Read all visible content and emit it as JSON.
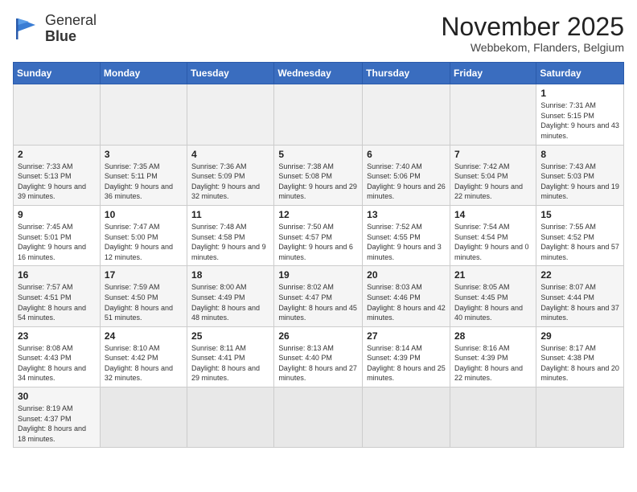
{
  "header": {
    "logo_text_normal": "General",
    "logo_text_bold": "Blue",
    "month_title": "November 2025",
    "location": "Webbekom, Flanders, Belgium"
  },
  "weekdays": [
    "Sunday",
    "Monday",
    "Tuesday",
    "Wednesday",
    "Thursday",
    "Friday",
    "Saturday"
  ],
  "weeks": [
    [
      {
        "day": "",
        "info": ""
      },
      {
        "day": "",
        "info": ""
      },
      {
        "day": "",
        "info": ""
      },
      {
        "day": "",
        "info": ""
      },
      {
        "day": "",
        "info": ""
      },
      {
        "day": "",
        "info": ""
      },
      {
        "day": "1",
        "info": "Sunrise: 7:31 AM\nSunset: 5:15 PM\nDaylight: 9 hours and 43 minutes."
      }
    ],
    [
      {
        "day": "2",
        "info": "Sunrise: 7:33 AM\nSunset: 5:13 PM\nDaylight: 9 hours and 39 minutes."
      },
      {
        "day": "3",
        "info": "Sunrise: 7:35 AM\nSunset: 5:11 PM\nDaylight: 9 hours and 36 minutes."
      },
      {
        "day": "4",
        "info": "Sunrise: 7:36 AM\nSunset: 5:09 PM\nDaylight: 9 hours and 32 minutes."
      },
      {
        "day": "5",
        "info": "Sunrise: 7:38 AM\nSunset: 5:08 PM\nDaylight: 9 hours and 29 minutes."
      },
      {
        "day": "6",
        "info": "Sunrise: 7:40 AM\nSunset: 5:06 PM\nDaylight: 9 hours and 26 minutes."
      },
      {
        "day": "7",
        "info": "Sunrise: 7:42 AM\nSunset: 5:04 PM\nDaylight: 9 hours and 22 minutes."
      },
      {
        "day": "8",
        "info": "Sunrise: 7:43 AM\nSunset: 5:03 PM\nDaylight: 9 hours and 19 minutes."
      }
    ],
    [
      {
        "day": "9",
        "info": "Sunrise: 7:45 AM\nSunset: 5:01 PM\nDaylight: 9 hours and 16 minutes."
      },
      {
        "day": "10",
        "info": "Sunrise: 7:47 AM\nSunset: 5:00 PM\nDaylight: 9 hours and 12 minutes."
      },
      {
        "day": "11",
        "info": "Sunrise: 7:48 AM\nSunset: 4:58 PM\nDaylight: 9 hours and 9 minutes."
      },
      {
        "day": "12",
        "info": "Sunrise: 7:50 AM\nSunset: 4:57 PM\nDaylight: 9 hours and 6 minutes."
      },
      {
        "day": "13",
        "info": "Sunrise: 7:52 AM\nSunset: 4:55 PM\nDaylight: 9 hours and 3 minutes."
      },
      {
        "day": "14",
        "info": "Sunrise: 7:54 AM\nSunset: 4:54 PM\nDaylight: 9 hours and 0 minutes."
      },
      {
        "day": "15",
        "info": "Sunrise: 7:55 AM\nSunset: 4:52 PM\nDaylight: 8 hours and 57 minutes."
      }
    ],
    [
      {
        "day": "16",
        "info": "Sunrise: 7:57 AM\nSunset: 4:51 PM\nDaylight: 8 hours and 54 minutes."
      },
      {
        "day": "17",
        "info": "Sunrise: 7:59 AM\nSunset: 4:50 PM\nDaylight: 8 hours and 51 minutes."
      },
      {
        "day": "18",
        "info": "Sunrise: 8:00 AM\nSunset: 4:49 PM\nDaylight: 8 hours and 48 minutes."
      },
      {
        "day": "19",
        "info": "Sunrise: 8:02 AM\nSunset: 4:47 PM\nDaylight: 8 hours and 45 minutes."
      },
      {
        "day": "20",
        "info": "Sunrise: 8:03 AM\nSunset: 4:46 PM\nDaylight: 8 hours and 42 minutes."
      },
      {
        "day": "21",
        "info": "Sunrise: 8:05 AM\nSunset: 4:45 PM\nDaylight: 8 hours and 40 minutes."
      },
      {
        "day": "22",
        "info": "Sunrise: 8:07 AM\nSunset: 4:44 PM\nDaylight: 8 hours and 37 minutes."
      }
    ],
    [
      {
        "day": "23",
        "info": "Sunrise: 8:08 AM\nSunset: 4:43 PM\nDaylight: 8 hours and 34 minutes."
      },
      {
        "day": "24",
        "info": "Sunrise: 8:10 AM\nSunset: 4:42 PM\nDaylight: 8 hours and 32 minutes."
      },
      {
        "day": "25",
        "info": "Sunrise: 8:11 AM\nSunset: 4:41 PM\nDaylight: 8 hours and 29 minutes."
      },
      {
        "day": "26",
        "info": "Sunrise: 8:13 AM\nSunset: 4:40 PM\nDaylight: 8 hours and 27 minutes."
      },
      {
        "day": "27",
        "info": "Sunrise: 8:14 AM\nSunset: 4:39 PM\nDaylight: 8 hours and 25 minutes."
      },
      {
        "day": "28",
        "info": "Sunrise: 8:16 AM\nSunset: 4:39 PM\nDaylight: 8 hours and 22 minutes."
      },
      {
        "day": "29",
        "info": "Sunrise: 8:17 AM\nSunset: 4:38 PM\nDaylight: 8 hours and 20 minutes."
      }
    ],
    [
      {
        "day": "30",
        "info": "Sunrise: 8:19 AM\nSunset: 4:37 PM\nDaylight: 8 hours and 18 minutes."
      },
      {
        "day": "",
        "info": ""
      },
      {
        "day": "",
        "info": ""
      },
      {
        "day": "",
        "info": ""
      },
      {
        "day": "",
        "info": ""
      },
      {
        "day": "",
        "info": ""
      },
      {
        "day": "",
        "info": ""
      }
    ]
  ]
}
